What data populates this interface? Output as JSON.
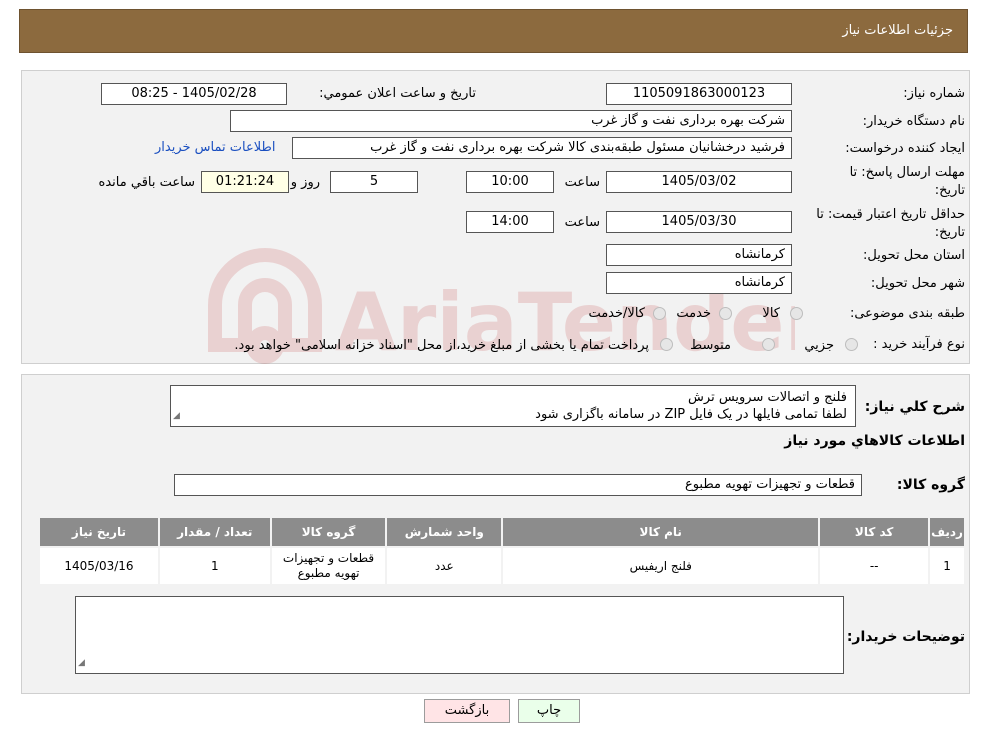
{
  "header": {
    "title": "جزئیات اطلاعات نیاز"
  },
  "fields": {
    "need_number_label": "شماره نیاز:",
    "need_number": "1105091863000123",
    "announce_label": "تاریخ و ساعت اعلان عمومي:",
    "announce_value": "1405/02/28 - 08:25",
    "buyer_org_label": "نام دستگاه خریدار:",
    "buyer_org": "شرکت بهره برداری نفت و گاز غرب",
    "creator_label": "ایجاد کننده درخواست:",
    "creator": "فرشید درخشانیان مسئول طبقه‌بندی کالا شرکت بهره برداری نفت و گاز غرب",
    "contact_link": "اطلاعات تماس خریدار",
    "reply_deadline_label_1": "مهلت ارسال پاسخ: تا",
    "reply_deadline_label_2": "تاریخ:",
    "reply_date": "1405/03/02",
    "time_label": "ساعت",
    "reply_time": "10:00",
    "days_value": "5",
    "days_label": "روز و",
    "remaining_time": "01:21:24",
    "remaining_label": "ساعت باقي مانده",
    "validity_label_1": "حداقل تاریخ اعتبار قیمت: تا",
    "validity_label_2": "تاریخ:",
    "validity_date": "1405/03/30",
    "validity_time": "14:00",
    "province_label": "استان محل تحویل:",
    "province": "کرمانشاه",
    "city_label": "شهر محل تحویل:",
    "city": "کرمانشاه",
    "category_label": "طبقه بندی موضوعی:",
    "category_options": [
      "کالا",
      "خدمت",
      "کالا/خدمت"
    ],
    "process_label": "نوع فرآیند خرید :",
    "process_options": [
      "جزیي",
      "متوسط"
    ],
    "process_note": "پرداخت تمام یا بخشی از مبلغ خرید،از محل \"اسناد خزانه اسلامی\" خواهد بود."
  },
  "watermark": {
    "text": "AriaTender.neT"
  },
  "description": {
    "label": "شرح کلي نیاز:",
    "line1": "فلنج و اتصالات سرویس ترش",
    "line2": "لطفا تمامی فایلها در یک فایل ZIP در سامانه باگزاری شود"
  },
  "goods": {
    "section_title": "اطلاعات کالاهاي مورد نیاز",
    "group_label": "گروه کالا:",
    "group_value": "قطعات و تجهیزات تهویه مطبوع"
  },
  "table": {
    "headers": [
      "ردیف",
      "کد کالا",
      "نام کالا",
      "واحد شمارش",
      "گروه کالا",
      "تعداد / مقدار",
      "تاریخ نیاز"
    ],
    "rows": [
      [
        "1",
        "--",
        "فلنج اریفیس",
        "عدد",
        "قطعات و تجهیزات تهویه مطبوع",
        "1",
        "1405/03/16"
      ]
    ]
  },
  "buyer_notes": {
    "label": "توضیحات خریدار:",
    "value": ""
  },
  "buttons": {
    "print": "چاپ",
    "back": "بازگشت"
  },
  "colors": {
    "header_bg": "#8c6a3e",
    "table_header_bg": "#8c8c8c",
    "link": "#1a4fc0"
  }
}
